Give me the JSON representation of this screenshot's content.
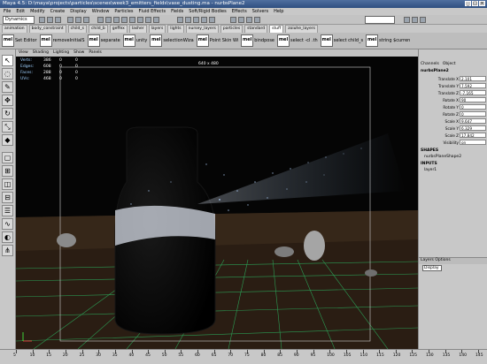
{
  "window": {
    "title": "Maya 4.5: D:\\maya\\projects\\particles\\scenes\\week3_emitters_fields\\vase_dusting.ma  -  nurbsPlane2"
  },
  "menubar": [
    "File",
    "Edit",
    "Modify",
    "Create",
    "Display",
    "Window",
    "Particles",
    "Fluid Effects",
    "Fields",
    "Soft/Rigid Bodies",
    "Effects",
    "Solvers",
    "Help"
  ],
  "statusline": {
    "menu_set": "Dynamics"
  },
  "shelf_tabs": [
    "animation",
    "body_constraint",
    "child_s",
    "child_b",
    "geffex",
    "lasher",
    "layers",
    "lights",
    "nursey_layers",
    "particles",
    "standard",
    "stuff",
    "zoiuhe_layers"
  ],
  "shelf_active": 11,
  "shelf_items": [
    {
      "icon": "mel",
      "label": "Set Editor"
    },
    {
      "icon": "mel",
      "label": "removeInitialS"
    },
    {
      "icon": "mel",
      "label": "separate"
    },
    {
      "icon": "mel",
      "label": "unity"
    },
    {
      "icon": "mel",
      "label": "selectionWiza"
    },
    {
      "icon": "mel",
      "label": "Point Skin Wi"
    },
    {
      "icon": "mel",
      "label": "bindpose"
    },
    {
      "icon": "mel",
      "label": "select -cl  .th"
    },
    {
      "icon": "mel",
      "label": "select child_s"
    },
    {
      "icon": "mel",
      "label": "string $curren"
    }
  ],
  "viewport": {
    "menu": [
      "View",
      "Shading",
      "Lighting",
      "Show",
      "Panels"
    ],
    "resolution": "640 x 480",
    "hud": [
      {
        "label": "Verts:",
        "a": "386",
        "b": "0",
        "c": "0"
      },
      {
        "label": "Edges:",
        "a": "608",
        "b": "0",
        "c": "0"
      },
      {
        "label": "Faces:",
        "a": "288",
        "b": "0",
        "c": "0"
      },
      {
        "label": "UVs:",
        "a": "468",
        "b": "0",
        "c": "0"
      }
    ]
  },
  "channel_box": {
    "tabs": [
      "Channels",
      "Object"
    ],
    "object": "nurbsPlane2",
    "attributes": [
      {
        "name": "Translate X",
        "value": "2.101"
      },
      {
        "name": "Translate Y",
        "value": "7.592"
      },
      {
        "name": "Translate Z",
        "value": "-7.165"
      },
      {
        "name": "Rotate X",
        "value": "90"
      },
      {
        "name": "Rotate Y",
        "value": "0"
      },
      {
        "name": "Rotate Z",
        "value": "0"
      },
      {
        "name": "Scale X",
        "value": "9.647"
      },
      {
        "name": "Scale Y",
        "value": "6.329"
      },
      {
        "name": "Scale Z",
        "value": "17.842"
      },
      {
        "name": "Visibility",
        "value": "on"
      }
    ],
    "shapes_header": "SHAPES",
    "shape_name": "nurbsPlaneShape2",
    "inputs_header": "INPUTS",
    "input_name": "layer1"
  },
  "layer_editor": {
    "header": "Layers  Options",
    "display": "Display"
  },
  "timeline": {
    "ticks": [
      "5",
      "10",
      "15",
      "20",
      "25",
      "30",
      "35",
      "40",
      "45",
      "50",
      "55",
      "60",
      "65",
      "70",
      "75",
      "80",
      "85",
      "90",
      "95",
      "100",
      "105",
      "110",
      "115",
      "120",
      "125",
      "130",
      "135",
      "140",
      "145"
    ]
  },
  "colors": {
    "ui_gray": "#c8c8c8",
    "viewport_bg": "#000000",
    "grid_green": "#2cc86a",
    "floor_brown": "#3a2a1c",
    "particle_blue": "#8fb8e6",
    "title_blue": "#3d5f91"
  }
}
